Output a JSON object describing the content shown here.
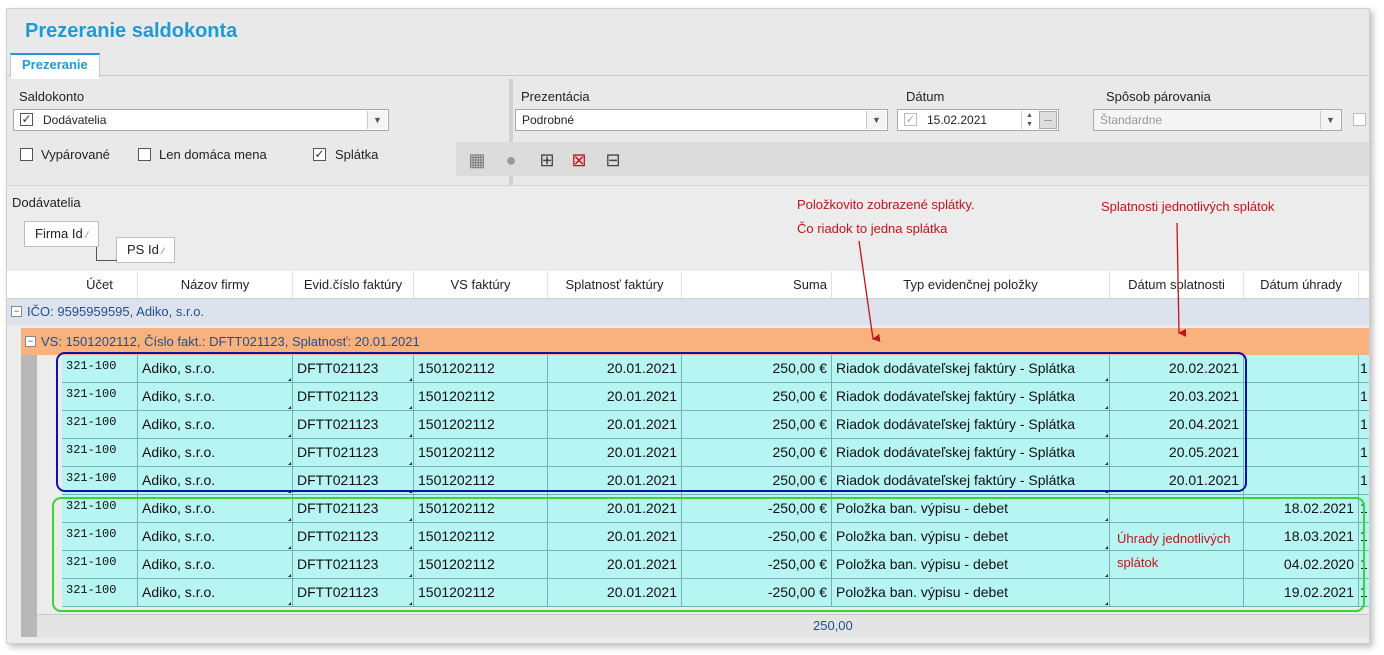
{
  "window": {
    "title": "Prezeranie saldokonta",
    "tab": "Prezeranie"
  },
  "filters": {
    "saldokonto_label": "Saldokonto",
    "saldokonto_value": "Dodávatelia",
    "prezentacia_label": "Prezentácia",
    "prezentacia_value": "Podrobné",
    "datum_label": "Dátum",
    "datum_value": "15.02.2021",
    "datum_button": "...",
    "sposob_label": "Spôsob párovania",
    "sposob_value": "Štandardne",
    "vyparovane": {
      "label": "Vypárované",
      "checked": false
    },
    "len_domaca": {
      "label": "Len domáca mena",
      "checked": false
    },
    "splatka": {
      "label": "Splátka",
      "checked": true
    }
  },
  "toolbar": {
    "icons": [
      "building-icon",
      "person-icon",
      "add-rows-icon",
      "delete-rows-icon",
      "split-columns-icon"
    ]
  },
  "grid": {
    "section_title": "Dodávatelia",
    "group_tags": [
      "Firma Id",
      "PS Id"
    ],
    "columns": [
      "Účet",
      "Názov firmy",
      "Evid.číslo faktúry",
      "VS faktúry",
      "Splatnosť faktúry",
      "Suma",
      "Typ evidenčnej položky",
      "Dátum splatnosti",
      "Dátum úhrady"
    ],
    "group1": "IČO: 9595959595, Adiko, s.r.o.",
    "group2": "VS: 1501202112, Číslo fakt.: DFTT021123, Splatnosť: 20.01.2021",
    "rows": [
      {
        "ucet": "321-100",
        "nazov": "Adiko, s.r.o.",
        "evid": "DFTT021123",
        "vs": "1501202112",
        "splatnost": "20.01.2021",
        "suma": "250,00 €",
        "typ": "Riadok dodávateľskej faktúry - Splátka",
        "datum_splatnosti": "20.02.2021",
        "datum_uhrady": "",
        "extra": "1"
      },
      {
        "ucet": "321-100",
        "nazov": "Adiko, s.r.o.",
        "evid": "DFTT021123",
        "vs": "1501202112",
        "splatnost": "20.01.2021",
        "suma": "250,00 €",
        "typ": "Riadok dodávateľskej faktúry - Splátka",
        "datum_splatnosti": "20.03.2021",
        "datum_uhrady": "",
        "extra": "1"
      },
      {
        "ucet": "321-100",
        "nazov": "Adiko, s.r.o.",
        "evid": "DFTT021123",
        "vs": "1501202112",
        "splatnost": "20.01.2021",
        "suma": "250,00 €",
        "typ": "Riadok dodávateľskej faktúry - Splátka",
        "datum_splatnosti": "20.04.2021",
        "datum_uhrady": "",
        "extra": "1"
      },
      {
        "ucet": "321-100",
        "nazov": "Adiko, s.r.o.",
        "evid": "DFTT021123",
        "vs": "1501202112",
        "splatnost": "20.01.2021",
        "suma": "250,00 €",
        "typ": "Riadok dodávateľskej faktúry - Splátka",
        "datum_splatnosti": "20.05.2021",
        "datum_uhrady": "",
        "extra": "1"
      },
      {
        "ucet": "321-100",
        "nazov": "Adiko, s.r.o.",
        "evid": "DFTT021123",
        "vs": "1501202112",
        "splatnost": "20.01.2021",
        "suma": "250,00 €",
        "typ": "Riadok dodávateľskej faktúry - Splátka",
        "datum_splatnosti": "20.01.2021",
        "datum_uhrady": "",
        "extra": "1"
      },
      {
        "ucet": "321-100",
        "nazov": "Adiko, s.r.o.",
        "evid": "DFTT021123",
        "vs": "1501202112",
        "splatnost": "20.01.2021",
        "suma": "-250,00 €",
        "typ": "Položka ban. výpisu - debet",
        "datum_splatnosti": "",
        "datum_uhrady": "18.02.2021",
        "extra": "1"
      },
      {
        "ucet": "321-100",
        "nazov": "Adiko, s.r.o.",
        "evid": "DFTT021123",
        "vs": "1501202112",
        "splatnost": "20.01.2021",
        "suma": "-250,00 €",
        "typ": "Položka ban. výpisu - debet",
        "datum_splatnosti": "",
        "datum_uhrady": "18.03.2021",
        "extra": "1"
      },
      {
        "ucet": "321-100",
        "nazov": "Adiko, s.r.o.",
        "evid": "DFTT021123",
        "vs": "1501202112",
        "splatnost": "20.01.2021",
        "suma": "-250,00 €",
        "typ": "Položka ban. výpisu - debet",
        "datum_splatnosti": "",
        "datum_uhrady": "04.02.2020",
        "extra": "1"
      },
      {
        "ucet": "321-100",
        "nazov": "Adiko, s.r.o.",
        "evid": "DFTT021123",
        "vs": "1501202112",
        "splatnost": "20.01.2021",
        "suma": "-250,00 €",
        "typ": "Položka ban. výpisu - debet",
        "datum_splatnosti": "",
        "datum_uhrady": "19.02.2021",
        "extra": "1"
      }
    ],
    "total": "250,00"
  },
  "annotations": {
    "note1_line1": "Položkovito zobrazené splátky.",
    "note1_line2": "Čo riadok to jedna splátka",
    "note2": "Splatnosti jednotlivých splátok",
    "note3_line1": "Úhrady jednotlivých",
    "note3_line2": "splátok"
  },
  "colors": {
    "accent": "#1e9bd6",
    "row_bg": "#b7f5f3",
    "group_bg": "#f9b27d",
    "annotation": "#c0141b",
    "highlight_blue": "#0b14a6",
    "highlight_green": "#3ad33a"
  }
}
